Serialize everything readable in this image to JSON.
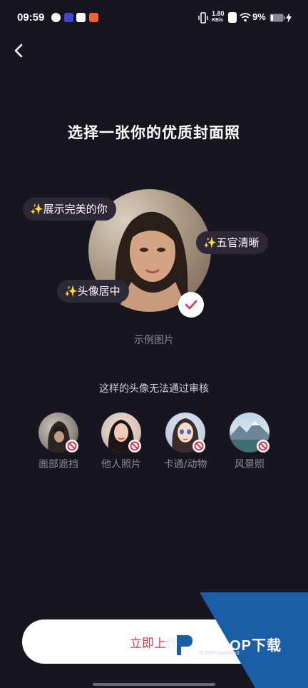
{
  "status_bar": {
    "time": "09:59",
    "net_speed_top": "1.80",
    "net_speed_bottom": "KB/s",
    "battery": "9%",
    "icons": [
      "weibo-icon",
      "video-icon",
      "mail-icon",
      "app-icon",
      "vibrate-icon",
      "sim-icon",
      "wifi-icon",
      "battery-icon",
      "charging-icon"
    ]
  },
  "header": {
    "back_icon": "chevron-left-icon",
    "title": "选择一张你的优质封面照"
  },
  "example": {
    "tags": [
      "✨展示完美的你",
      "✨五官清晰",
      "✨头像居中"
    ],
    "caption": "示例图片",
    "badge_icon": "check-icon"
  },
  "rejections": {
    "heading": "这样的头像无法通过审核",
    "items": [
      {
        "label": "面部遮挡",
        "badge_icon": "prohibited-icon"
      },
      {
        "label": "他人照片",
        "badge_icon": "prohibited-icon"
      },
      {
        "label": "卡通/动物",
        "badge_icon": "prohibited-icon"
      },
      {
        "label": "风景照",
        "badge_icon": "prohibited-icon"
      }
    ]
  },
  "footer": {
    "upload_label": "立即上传"
  },
  "watermark": {
    "brand": "PCPOP下载",
    "sub": "PCPOP Download"
  },
  "colors": {
    "background": "#17151f",
    "tag_bg": "#2c2838",
    "accent": "#e2334a",
    "muted_text": "#8f8c99"
  }
}
